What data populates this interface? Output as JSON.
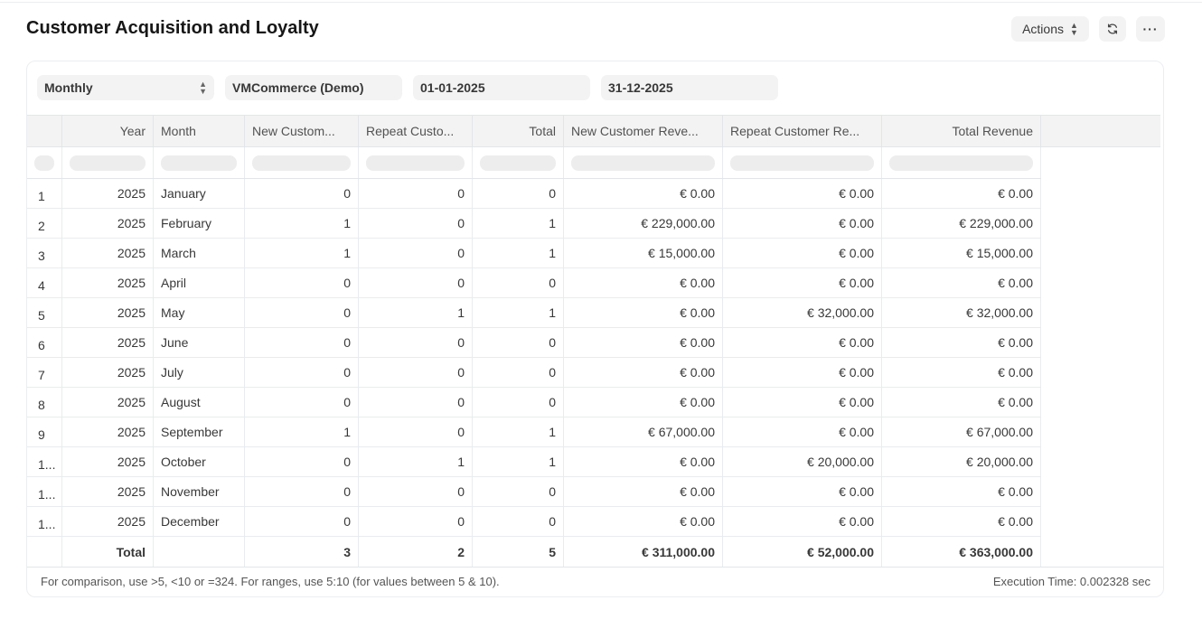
{
  "page": {
    "title": "Customer Acquisition and Loyalty"
  },
  "header": {
    "actions_label": "Actions",
    "refresh_icon": "refresh-icon",
    "more_label": "···"
  },
  "filters": {
    "period": "Monthly",
    "company": "VMCommerce (Demo)",
    "from_date": "01-01-2025",
    "to_date": "31-12-2025"
  },
  "columns": [
    "Year",
    "Month",
    "New Custom...",
    "Repeat Custo...",
    "Total",
    "New Customer Reve...",
    "Repeat Customer Re...",
    "Total Revenue"
  ],
  "rows": [
    {
      "idx": "1",
      "year": "2025",
      "month": "January",
      "new": "0",
      "repeat": "0",
      "total": "0",
      "new_rev": "€ 0.00",
      "repeat_rev": "€ 0.00",
      "total_rev": "€ 0.00"
    },
    {
      "idx": "2",
      "year": "2025",
      "month": "February",
      "new": "1",
      "repeat": "0",
      "total": "1",
      "new_rev": "€ 229,000.00",
      "repeat_rev": "€ 0.00",
      "total_rev": "€ 229,000.00"
    },
    {
      "idx": "3",
      "year": "2025",
      "month": "March",
      "new": "1",
      "repeat": "0",
      "total": "1",
      "new_rev": "€ 15,000.00",
      "repeat_rev": "€ 0.00",
      "total_rev": "€ 15,000.00"
    },
    {
      "idx": "4",
      "year": "2025",
      "month": "April",
      "new": "0",
      "repeat": "0",
      "total": "0",
      "new_rev": "€ 0.00",
      "repeat_rev": "€ 0.00",
      "total_rev": "€ 0.00"
    },
    {
      "idx": "5",
      "year": "2025",
      "month": "May",
      "new": "0",
      "repeat": "1",
      "total": "1",
      "new_rev": "€ 0.00",
      "repeat_rev": "€ 32,000.00",
      "total_rev": "€ 32,000.00"
    },
    {
      "idx": "6",
      "year": "2025",
      "month": "June",
      "new": "0",
      "repeat": "0",
      "total": "0",
      "new_rev": "€ 0.00",
      "repeat_rev": "€ 0.00",
      "total_rev": "€ 0.00"
    },
    {
      "idx": "7",
      "year": "2025",
      "month": "July",
      "new": "0",
      "repeat": "0",
      "total": "0",
      "new_rev": "€ 0.00",
      "repeat_rev": "€ 0.00",
      "total_rev": "€ 0.00"
    },
    {
      "idx": "8",
      "year": "2025",
      "month": "August",
      "new": "0",
      "repeat": "0",
      "total": "0",
      "new_rev": "€ 0.00",
      "repeat_rev": "€ 0.00",
      "total_rev": "€ 0.00"
    },
    {
      "idx": "9",
      "year": "2025",
      "month": "September",
      "new": "1",
      "repeat": "0",
      "total": "1",
      "new_rev": "€ 67,000.00",
      "repeat_rev": "€ 0.00",
      "total_rev": "€ 67,000.00"
    },
    {
      "idx": "1...",
      "year": "2025",
      "month": "October",
      "new": "0",
      "repeat": "1",
      "total": "1",
      "new_rev": "€ 0.00",
      "repeat_rev": "€ 20,000.00",
      "total_rev": "€ 20,000.00"
    },
    {
      "idx": "1...",
      "year": "2025",
      "month": "November",
      "new": "0",
      "repeat": "0",
      "total": "0",
      "new_rev": "€ 0.00",
      "repeat_rev": "€ 0.00",
      "total_rev": "€ 0.00"
    },
    {
      "idx": "1...",
      "year": "2025",
      "month": "December",
      "new": "0",
      "repeat": "0",
      "total": "0",
      "new_rev": "€ 0.00",
      "repeat_rev": "€ 0.00",
      "total_rev": "€ 0.00"
    }
  ],
  "totals": {
    "label": "Total",
    "new": "3",
    "repeat": "2",
    "total": "5",
    "new_rev": "€ 311,000.00",
    "repeat_rev": "€ 52,000.00",
    "total_rev": "€ 363,000.00"
  },
  "footer": {
    "hint": "For comparison, use >5, <10 or =324. For ranges, use 5:10 (for values between 5 & 10).",
    "execution_time": "Execution Time: 0.002328 sec"
  }
}
